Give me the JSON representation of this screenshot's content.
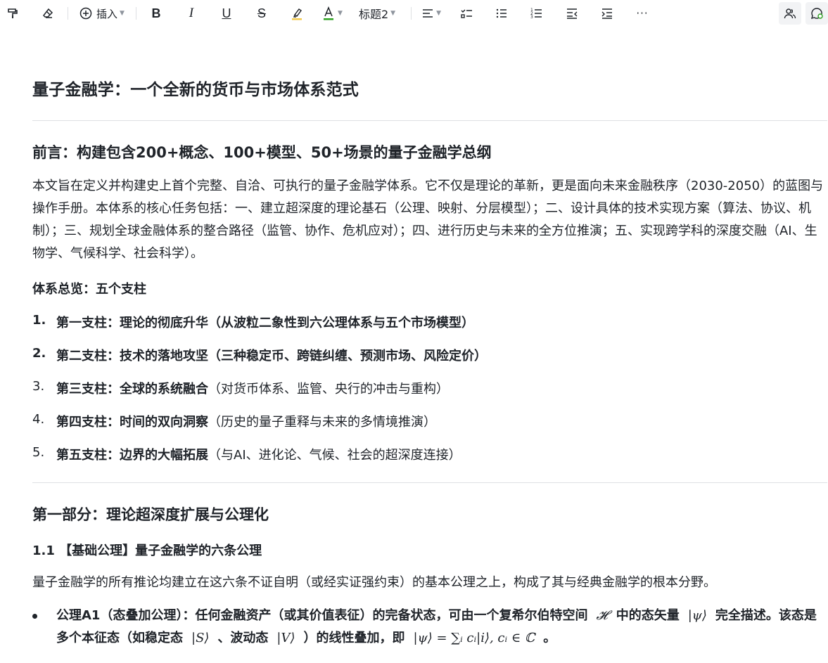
{
  "toolbar": {
    "insert_label": "插入",
    "heading_label": "标题2",
    "more_label": "···"
  },
  "doc": {
    "title": "量子金融学：一个全新的货币与市场体系范式",
    "preface_heading": "前言：构建包含200+概念、100+模型、50+场景的量子金融学总纲",
    "preface_paragraph": "本文旨在定义并构建史上首个完整、自洽、可执行的量子金融学体系。它不仅是理论的革新，更是面向未来金融秩序（2030-2050）的蓝图与操作手册。本体系的核心任务包括：一、建立超深度的理论基石（公理、映射、分层模型）；二、设计具体的技术实现方案（算法、协议、机制）；三、规划全球金融体系的整合路径（监管、协作、危机应对）；四、进行历史与未来的全方位推演；五、实现跨学科的深度交融（AI、生物学、气候科学、社会科学）。",
    "overview_label": "体系总览：五个支柱",
    "pillars": [
      {
        "num": "1.",
        "bold": "第一支柱：理论的彻底升华（从波粒二象性到六公理体系与五个市场模型）",
        "rest": ""
      },
      {
        "num": "2.",
        "bold": "第二支柱：技术的落地攻坚（三种稳定币、跨链纠缠、预测市场、风险定价）",
        "rest": ""
      },
      {
        "num": "3.",
        "bold": "第三支柱：全球的系统融合",
        "rest": "（对货币体系、监管、央行的冲击与重构）"
      },
      {
        "num": "4.",
        "bold": "第四支柱：时间的双向洞察",
        "rest": "（历史的量子重释与未来的多情境推演）"
      },
      {
        "num": "5.",
        "bold": "第五支柱：边界的大幅拓展",
        "rest": "（与AI、进化论、气候、社会的超深度连接）"
      }
    ],
    "part1_heading": "第一部分：理论超深度扩展与公理化",
    "section_1_1": "1.1 【基础公理】量子金融学的六条公理",
    "section_1_1_paragraph": "量子金融学的所有推论均建立在这六条不证自明（或经实证强约束）的基本公理之上，构成了其与经典金融学的根本分野。",
    "axiom_a1": {
      "part1": "公理A1（态叠加公理）：任何金融资产（或其价值表征）的完备状态，可由一个复希尔伯特空间",
      "math_h": "𝓗",
      "part2": "中的态矢量",
      "math_psi": "|ψ⟩",
      "part3": "完全描述。该态是多个本征态（如稳定态",
      "math_s": "|S⟩",
      "part4": "、波动态",
      "math_v": "|V⟩",
      "part5": "）的线性叠加，即",
      "math_sum": "|ψ⟩ = ∑ᵢ cᵢ|i⟩,   cᵢ ∈ ℂ",
      "part6": "。"
    }
  }
}
